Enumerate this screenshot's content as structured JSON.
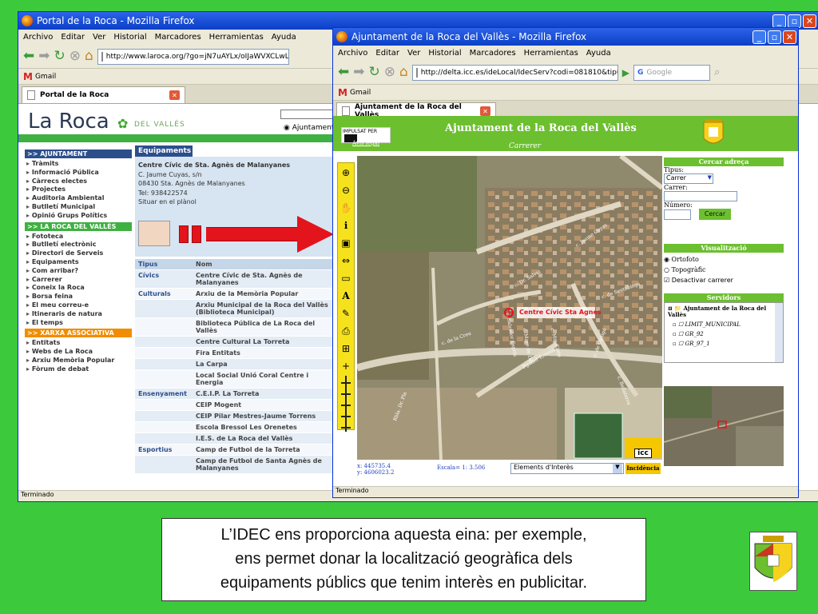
{
  "win1": {
    "title": "Portal de la Roca - Mozilla Firefox",
    "menu": [
      "Archivo",
      "Editar",
      "Ver",
      "Historial",
      "Marcadores",
      "Herramientas",
      "Ayuda"
    ],
    "url": "http://www.laroca.org/?go=jN7uAYLx/oIJaWVXCLwLD8jzj8R",
    "bookmark": "Gmail",
    "tab": "Portal de la Roca",
    "status": "Terminado"
  },
  "laroca": {
    "logo": "La Roca",
    "logo_sub": "DEL VALLÈS",
    "radio": "Ajuntament",
    "sections": [
      {
        "title": ">> AJUNTAMENT",
        "items": [
          "Tràmits",
          "Informació Pública",
          "Càrrecs electes",
          "Projectes",
          "Auditoria Ambiental",
          "Butlletí Municipal",
          "Opinió Grups Polítics"
        ]
      },
      {
        "title": ">> LA ROCA DEL VALLÈS",
        "items": [
          "Fototeca",
          "Butlletí electrònic",
          "Directori de Serveis",
          "Equipaments",
          "Com arribar?",
          "Carrerer",
          "Coneix la Roca",
          "Borsa feina",
          "El meu correu-e",
          "Itineraris de natura",
          "El temps"
        ]
      },
      {
        "title": ">> XARXA ASSOCIATIVA",
        "items": [
          "Entitats",
          "Webs de La Roca",
          "Arxiu Memòria Popular",
          "Fòrum de debat"
        ]
      }
    ],
    "equip_title": "Equipaments",
    "centre": {
      "name": "Centre Cívic de Sta. Agnès de Malanyanes",
      "addr": "C. Jaume Cuyas, s/n",
      "city": "08430 Sta. Agnès de Malanyanes",
      "tel": "Tel: 938422574",
      "link": "Situar en el plànol"
    },
    "table_header": {
      "tipus": "Tipus",
      "nom": "Nom"
    },
    "rows": [
      {
        "tipus": "Cívics",
        "nom": "Centre Cívic de Sta. Agnès de Malanyanes"
      },
      {
        "tipus": "Culturals",
        "nom": "Arxiu de la Memòria Popular"
      },
      {
        "tipus": "",
        "nom": "Arxiu Municipal de la Roca del Vallès (Biblioteca Municipal)"
      },
      {
        "tipus": "",
        "nom": "Biblioteca Pública de La Roca del Vallès"
      },
      {
        "tipus": "",
        "nom": "Centre Cultural La Torreta"
      },
      {
        "tipus": "",
        "nom": "Fira Entitats"
      },
      {
        "tipus": "",
        "nom": "La Carpa"
      },
      {
        "tipus": "",
        "nom": "Local Social Unió Coral Centre i Energia"
      },
      {
        "tipus": "Ensenyament",
        "nom": "C.E.I.P. La Torreta"
      },
      {
        "tipus": "",
        "nom": "CEIP Mogent"
      },
      {
        "tipus": "",
        "nom": "CEIP Pilar Mestres-Jaume Torrens"
      },
      {
        "tipus": "",
        "nom": "Escola Bressol Les Orenetes"
      },
      {
        "tipus": "",
        "nom": "I.E.S. de La Roca del Vallès"
      },
      {
        "tipus": "Esportius",
        "nom": "Camp de Futbol de la Torreta"
      },
      {
        "tipus": "",
        "nom": "Camp de Futbol de Santa Agnès de Malanyanes"
      }
    ]
  },
  "win2": {
    "title": "Ajuntament de la Roca del Vallès - Mozilla Firefox",
    "menu": [
      "Archivo",
      "Editar",
      "Ver",
      "Historial",
      "Marcadores",
      "Herramientas",
      "Ayuda"
    ],
    "url": "http://delta.icc.es/ideLocal/IdecServ?codi=081810&tipus=c&x=",
    "search_placeholder": "Google",
    "bookmark": "Gmail",
    "tab": "Ajuntament de la Roca del Vallès",
    "status": "Terminado"
  },
  "idec": {
    "logo": "IMPULSAT PER",
    "avis": "Avís legal",
    "title": "Ajuntament de la Roca del Vallès",
    "subtitle": "Carrerer",
    "map_marker": "Centre Cívic Sta Agnes",
    "street_labels": [
      "c. Jaume Cuyas",
      "c. de Sentabings",
      "Pg. del Torrent",
      "Rbla. Dr. Pla",
      "c. Salvador Espriu",
      "c. Mare de Déu",
      "c. Mn. Cinto",
      "c. de Canigó",
      "c. Dr. Salvat",
      "c. Bellaterra",
      "c. de la Creu"
    ],
    "coord_x": "x: 445735.4",
    "coord_y": "y: 4606023.2",
    "escala": "Escala= 1: 3.506",
    "elements_select": "Elements d'Interès",
    "incidencia": "Incidència",
    "cicc": "icc",
    "panel": {
      "cercar_title": "Cercar adreça",
      "tipus_label": "Tipus:",
      "tipus_value": "Carrer",
      "carrer_label": "Carrer:",
      "numero_label": "Número:",
      "cercar_button": "Cercar",
      "visual_title": "Visualització",
      "ortofoto": "Ortofoto",
      "topografic": "Topogràfic",
      "desactivar": "Desactivar carrerer",
      "servidors_title": "Servidors",
      "tree_root": "Ajuntament de la Roca del Vallès",
      "tree_items": [
        "LIMIT_MUNICIPAL",
        "GR_92",
        "GR_97_1"
      ]
    }
  },
  "caption": {
    "line1": "L’IDEC ens proporciona aquesta eina: per exemple,",
    "line2": "ens permet donar la localització geogràfica dels",
    "line3": "equipaments públics que tenim interès en publicitar."
  },
  "colors": {
    "background": "#3cc93c",
    "titlebar": "#0a3fc6",
    "idec_green": "#6cbf2f",
    "arrow": "#e3141b"
  }
}
